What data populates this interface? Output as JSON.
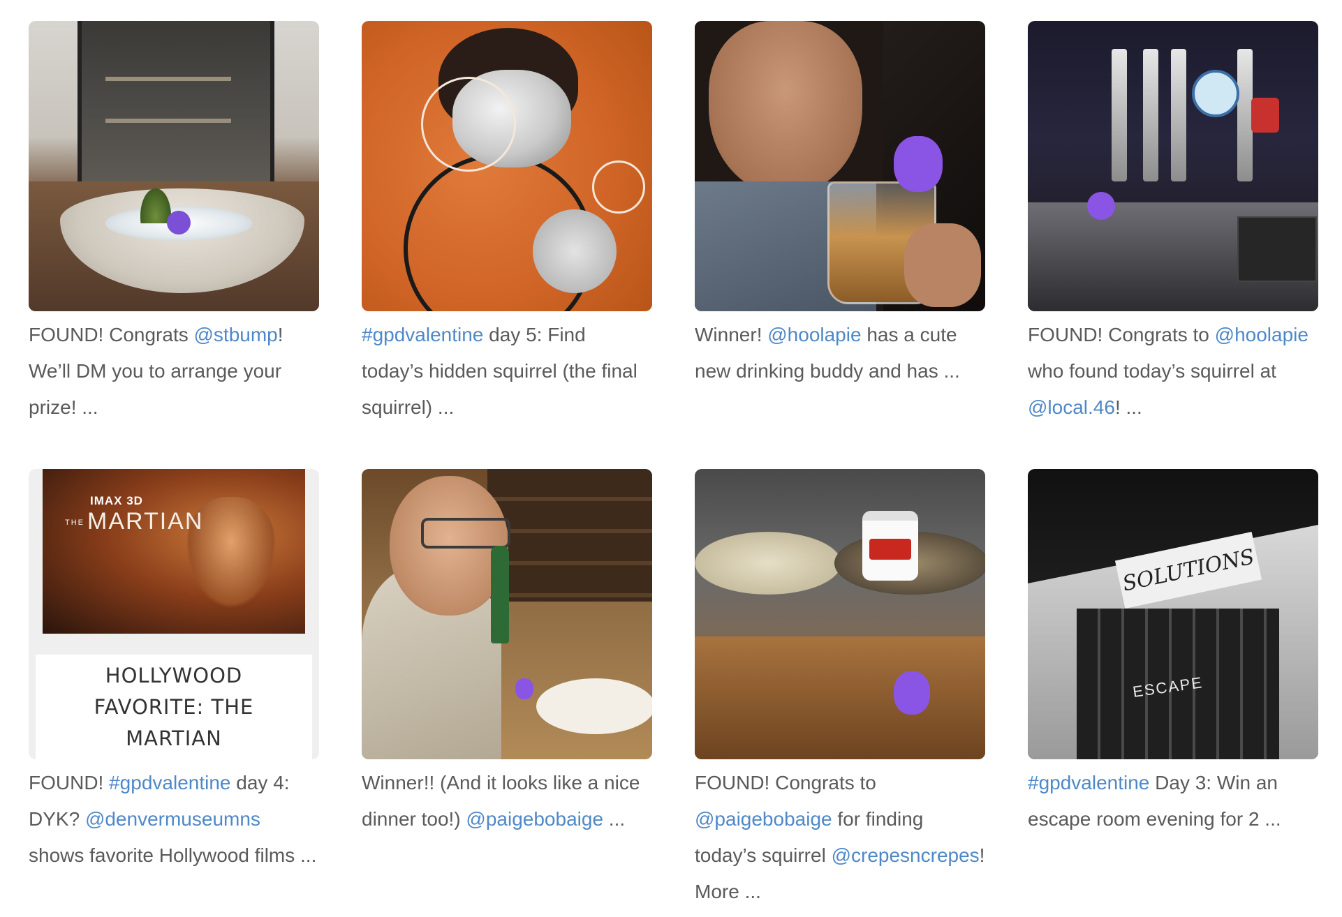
{
  "cards": [
    {
      "photo": "store display bowl with purple squirrel",
      "caption": {
        "p1": "FOUND! Congrats ",
        "link1": "@stbump",
        "p2": "! We’ll DM you to arrange your prize! ..."
      }
    },
    {
      "photo": "orange illustrated basketball portrait",
      "caption": {
        "link1": "#gpdvalentine",
        "p1": " day 5: Find today’s hidden squirrel (the final squirrel) ..."
      }
    },
    {
      "photo": "selfie with drink and purple squirrel",
      "caption": {
        "p1": "Winner! ",
        "link1": "@hoolapie",
        "p2": " has a cute new drinking buddy and has ..."
      }
    },
    {
      "photo": "bar beer taps with purple squirrel",
      "caption": {
        "p1": "FOUND! Congrats to ",
        "link1": "@hoolapie",
        "p2": " who found today’s squirrel at ",
        "link2": "@local.46",
        "p3": "! ..."
      }
    },
    {
      "promo": {
        "imax": "IMAX 3D",
        "the": "THE",
        "movie": "MARTIAN",
        "panel_title": "HOLLYWOOD FAVORITE: THE MARTIAN"
      },
      "caption": {
        "p1": "FOUND! ",
        "link1": "#gpdvalentine",
        "p2": " day 4: DYK? ",
        "link2": "@denvermuseumns",
        "p3": " shows favorite Hollywood films ..."
      }
    },
    {
      "photo": "man at restaurant holding purple squirrel",
      "caption": {
        "p1": "Winner!! (And it looks like a nice dinner too!) ",
        "link1": "@paigebobaige",
        "p2": " ..."
      }
    },
    {
      "photo": "crepe griddles with nutella jar and purple squirrel",
      "caption": {
        "p1": "FOUND! Congrats to ",
        "link1": "@paigebobaige",
        "p2": " for finding today’s squirrel ",
        "link2": "@crepesncrepes",
        "p3": "! More ..."
      }
    },
    {
      "photo": "Solutions Lounge escape room building",
      "sign": "SOLUTIONS",
      "escape": "ESCAPE",
      "caption": {
        "link1": "#gpdvalentine",
        "p1": " Day 3: Win an escape room evening for 2 ..."
      }
    }
  ],
  "colors": {
    "link": "#4f88c8",
    "text": "#5a5a5a",
    "squirrel": "#8a55e4"
  }
}
